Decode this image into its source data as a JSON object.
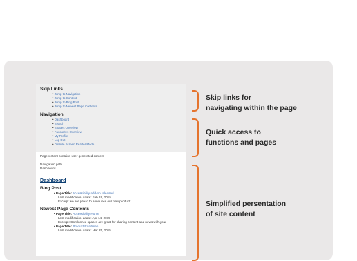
{
  "skip_links": {
    "title": "Skip Links",
    "items": [
      "Jump to Navigation",
      "Jump to Content",
      "Jump to Blog Post",
      "Jump to Newest Page Contents"
    ]
  },
  "navigation": {
    "title": "Navigation",
    "items": [
      "Dashboard",
      "Search",
      "Spaces Overview",
      "Favourites Overview",
      "My Profile",
      "Log Out",
      "Disable Screen Reader Mode"
    ]
  },
  "content": {
    "intro": "Pagecontent contains user generated content",
    "nav_path_label": "Navigation path",
    "nav_path_value": "Dashboard",
    "dashboard_title": "Dashboard",
    "blog_post": {
      "heading": "Blog Post",
      "title_label": "Page Title:",
      "title_value": "Accessibility add-on released",
      "modified": "Last modification daate: Feb 19, 2015",
      "excerpt": "Excerpt we are proud to announce our new product..."
    },
    "newest": {
      "heading": "Newest Page Contents",
      "item1_label": "Page Title:",
      "item1_value": "Accessibility Home",
      "item1_modified": "Last modification daate: Apr 14, 2015",
      "item1_excerpt": "Excerpt: Confluence spaces are great for sharing content and news with your",
      "item2_label": "Page Title:",
      "item2_value": "Product Roadmap",
      "item2_modified": "Last modification daate: Mar 25, 2015"
    }
  },
  "annotations": {
    "skip_line1": "Skip links for",
    "skip_line2": "navigating within the page",
    "quick_line1": "Quick access to",
    "quick_line2": "functions and pages",
    "simple_line1": "Simplified persentation",
    "simple_line2": "of site content"
  },
  "colors": {
    "accent": "#e5742e",
    "link": "#3f72b7",
    "panel": "#eae8e8",
    "dashboard": "#0c3e72"
  }
}
